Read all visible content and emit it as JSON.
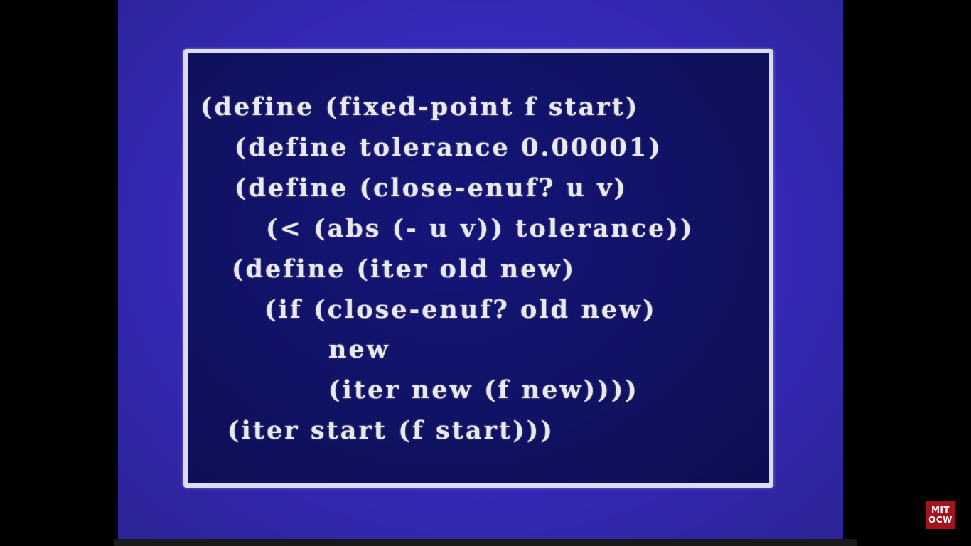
{
  "slide": {
    "code_lines": [
      "(define (fixed-point f start)",
      "(define tolerance 0.00001)",
      "(define (close-enuf? u v)",
      "(< (abs (- u v)) tolerance))",
      "(define (iter old new)",
      "(if (close-enuf? old new)",
      "new",
      "(iter new (f new))))",
      "(iter start (f start)))"
    ]
  },
  "watermark": {
    "line1": "MIT",
    "line2": "OCW",
    "bg_color": "#a3141f"
  },
  "player": {
    "progress_fraction": 0
  },
  "colors": {
    "screen_blue": "#3529b8",
    "panel_navy": "#101262",
    "border": "#dcdcf0",
    "text": "#e8e8ee"
  }
}
